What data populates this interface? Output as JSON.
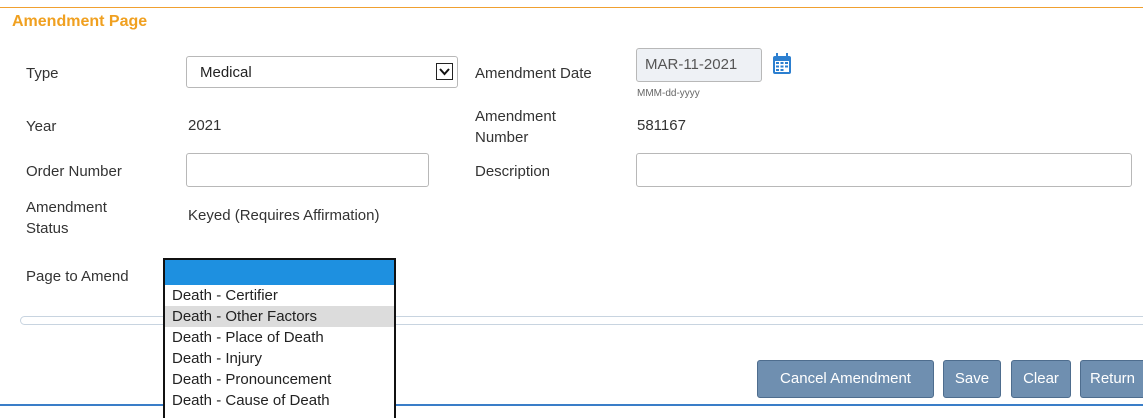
{
  "section_title": "Amendment Page",
  "form": {
    "type_label": "Type",
    "type_value": "Medical",
    "amendment_date_label": "Amendment Date",
    "amendment_date_value": "MAR-11-2021",
    "date_format_hint": "MMM-dd-yyyy",
    "year_label": "Year",
    "year_value": "2021",
    "amendment_number_label_line1": "Amendment",
    "amendment_number_label_line2": "Number",
    "amendment_number_value": "581167",
    "order_number_label": "Order Number",
    "order_number_value": "",
    "description_label": "Description",
    "description_value": "",
    "amendment_status_label_line1": "Amendment",
    "amendment_status_label_line2": "Status",
    "amendment_status_value": "Keyed (Requires Affirmation)",
    "page_to_amend_label": "Page to Amend"
  },
  "page_to_amend_options": [
    "",
    "Death - Certifier",
    "Death - Other Factors",
    "Death - Place of Death",
    "Death - Injury",
    "Death - Pronouncement",
    "Death - Cause of Death"
  ],
  "buttons": {
    "cancel_amendment": "Cancel Amendment",
    "save": "Save",
    "clear": "Clear",
    "return": "Return"
  },
  "icons": {
    "calendar": "calendar-icon",
    "select_arrow": "chevron-down-icon"
  },
  "colors": {
    "accent": "#f0a020",
    "button": "#6f8fb0",
    "highlight": "#1e90e0"
  }
}
